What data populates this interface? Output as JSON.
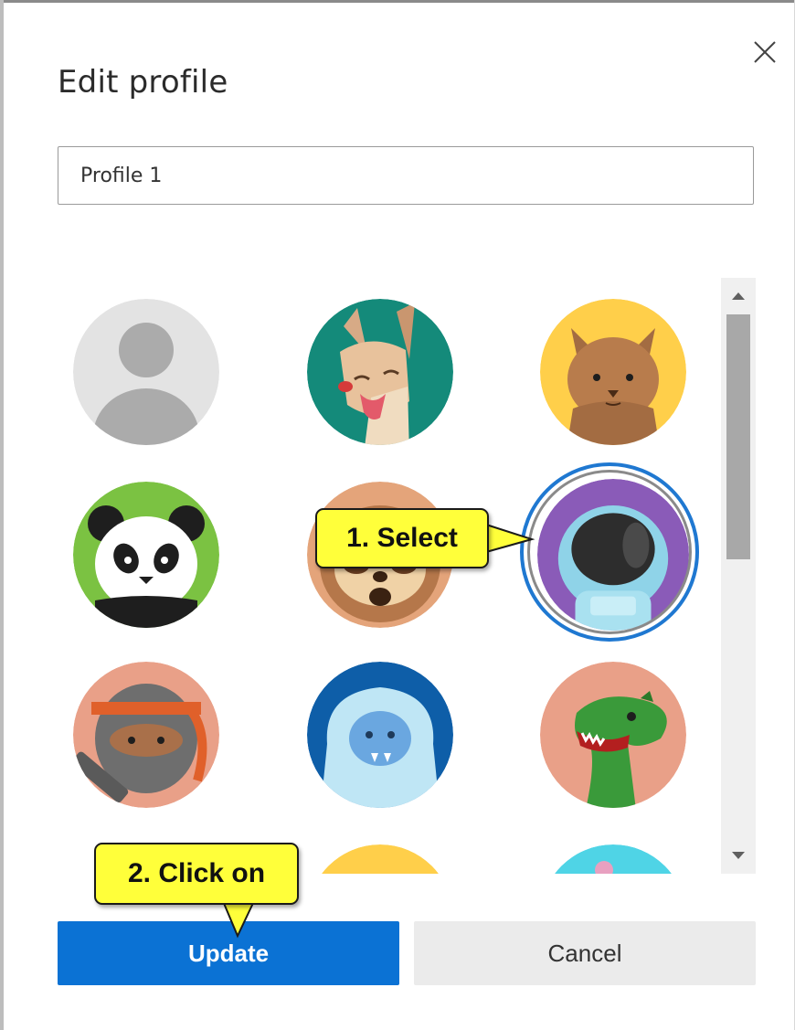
{
  "dialog": {
    "title": "Edit profile",
    "close_icon": "close-icon",
    "name_input": {
      "value": "Profile 1",
      "placeholder": ""
    }
  },
  "avatars": [
    {
      "name": "default-person",
      "bg": "#e3e3e3"
    },
    {
      "name": "dog",
      "bg": "#148a7a"
    },
    {
      "name": "cat",
      "bg": "#ffcf4a"
    },
    {
      "name": "panda",
      "bg": "#7bc242"
    },
    {
      "name": "sloth",
      "bg": "#e4a47a"
    },
    {
      "name": "astronaut",
      "bg": "#8a5bb8",
      "selected": true
    },
    {
      "name": "ninja",
      "bg": "#e9a088"
    },
    {
      "name": "yeti",
      "bg": "#0e5ea8"
    },
    {
      "name": "dinosaur",
      "bg": "#e9a088"
    }
  ],
  "buttons": {
    "update": "Update",
    "cancel": "Cancel"
  },
  "callouts": {
    "step1": "1. Select",
    "step2": "2. Click on"
  },
  "colors": {
    "accent": "#0b72d4",
    "selection_ring": "#1f78d1",
    "callout": "#ffff3a"
  }
}
